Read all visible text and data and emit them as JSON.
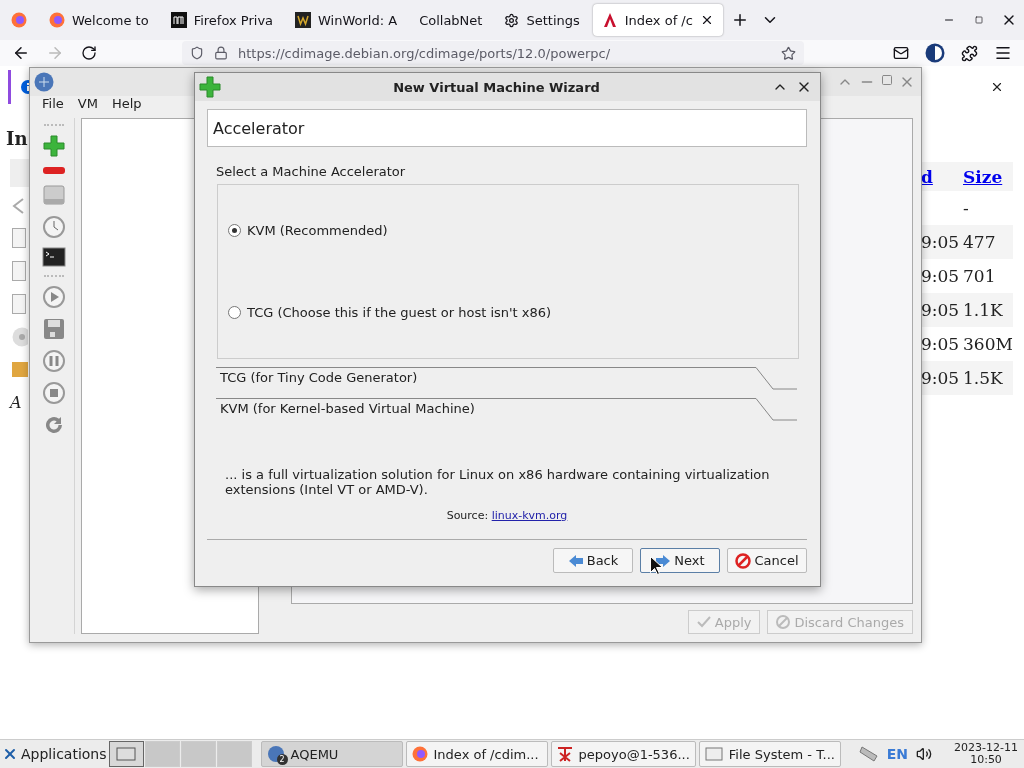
{
  "browser": {
    "tabs": [
      {
        "selected": false
      },
      {
        "label": "Welcome to",
        "selected": false
      },
      {
        "label": "Firefox Priva",
        "selected": false
      },
      {
        "label": "WinWorld: A",
        "selected": false
      },
      {
        "label": "CollabNet",
        "selected": false
      },
      {
        "label": "Settings",
        "selected": false
      },
      {
        "label": "Index of /c",
        "selected": true
      }
    ],
    "url": "https://cdimage.debian.org/cdimage/ports/12.0/powerpc/",
    "page": {
      "heading": "In",
      "italic_text": "A",
      "table": {
        "columns": [
          "d",
          "Size"
        ],
        "rows": [
          {
            "size": "-"
          },
          {
            "column_1": "9:05",
            "size": "477"
          },
          {
            "column_1": "9:05",
            "size": "701"
          },
          {
            "column_1": "9:05",
            "size": "1.1K"
          },
          {
            "column_1": "9:05",
            "size": "360M"
          },
          {
            "column_1": "9:05",
            "size": "1.5K"
          }
        ]
      }
    }
  },
  "aqemu": {
    "menu": [
      "File",
      "VM",
      "Help"
    ],
    "buttons": [
      {
        "label": "Apply",
        "disabled": true
      },
      {
        "label": "Discard Changes",
        "disabled": true
      }
    ]
  },
  "wizard": {
    "title": "New Virtual Machine Wizard",
    "page_title": "Accelerator",
    "group_label": "Select a Machine Accelerator",
    "options": [
      {
        "label": "KVM (Recommended)",
        "selected": true
      },
      {
        "label": "TCG (Choose this if the guest or host isn't x86)",
        "selected": false
      }
    ],
    "sections": [
      "TCG (for Tiny Code Generator)",
      "KVM (for Kernel-based Virtual Machine)"
    ],
    "description": "... is a full virtualization solution for Linux on x86 hardware containing virtualization extensions (Intel VT or AMD-V).",
    "source_label": "Source:",
    "source_link": "linux-kvm.org",
    "buttons": [
      {
        "label": "Back",
        "focused": false
      },
      {
        "label": "Next",
        "focused": true
      },
      {
        "label": "Cancel",
        "focused": false
      }
    ]
  },
  "taskbar": {
    "start": "Applications",
    "workspaces": [
      {
        "selected": true
      },
      {
        "selected": false
      },
      {
        "selected": false
      },
      {
        "selected": false
      }
    ],
    "tasks": [
      {
        "label": "AQEMU",
        "badge": "2",
        "selected": true
      },
      {
        "label": "Index of /cdim...",
        "selected": false
      },
      {
        "label": "pepoyo@1-536...",
        "selected": false
      },
      {
        "label": "File System - T...",
        "selected": false
      }
    ],
    "keyboard": "EN",
    "clock": {
      "date": "2023-12-11",
      "time": "10:50"
    }
  }
}
